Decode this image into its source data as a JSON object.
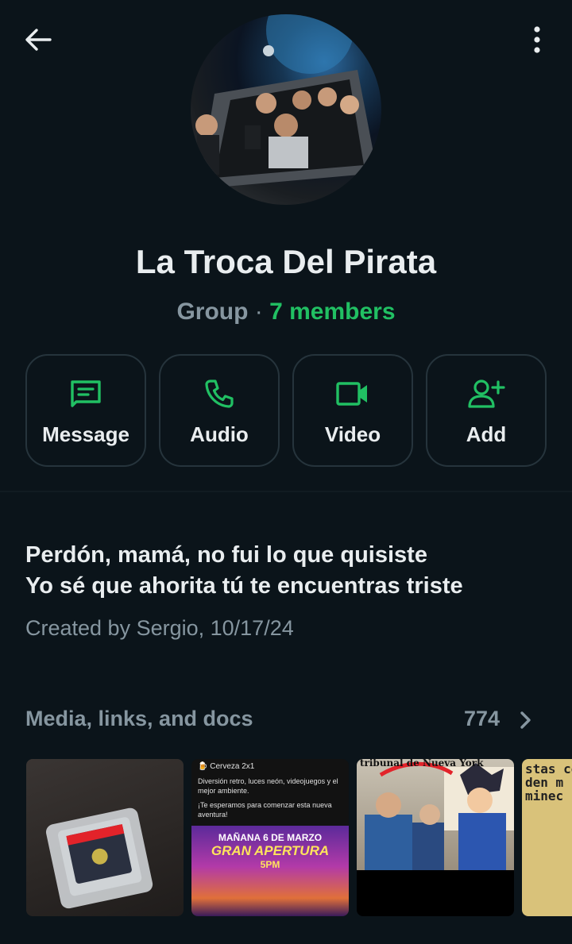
{
  "header": {
    "back_icon": "arrow-left-icon",
    "menu_icon": "more-vertical-icon"
  },
  "group": {
    "name": "La Troca Del Pirata",
    "kind": "Group",
    "separator": " · ",
    "members": "7 members"
  },
  "actions": [
    {
      "label": "Message",
      "icon": "message-icon"
    },
    {
      "label": "Audio",
      "icon": "phone-icon"
    },
    {
      "label": "Video",
      "icon": "video-camera-icon"
    },
    {
      "label": "Add",
      "icon": "add-person-icon"
    }
  ],
  "description": {
    "line1": "Perdón, mamá, no fui lo que quisiste",
    "line2": "Yo sé que ahorita tú te encuentras triste",
    "created": "Created by Sergio, 10/17/24"
  },
  "media": {
    "title": "Media, links, and docs",
    "count": "774",
    "thumbnails": {
      "t2": {
        "header": "🍺 Cerveza 2x1",
        "body1": "Diversión retro, luces neón, videojuegos y el mejor ambiente.",
        "body2": "¡Te esperamos para comenzar esta nueva aventura!",
        "poster_line1": "MAÑANA 6 DE MARZO",
        "poster_line2": "GRAN APERTURA",
        "poster_line3": "5PM"
      },
      "t3": {
        "caption": "tribunal de Nueva York"
      },
      "t4": {
        "caption": "stas co\nden m\nminec"
      }
    }
  },
  "colors": {
    "background": "#0b141a",
    "accent": "#21c063",
    "secondary_text": "#8696a0",
    "border": "#26343c"
  }
}
